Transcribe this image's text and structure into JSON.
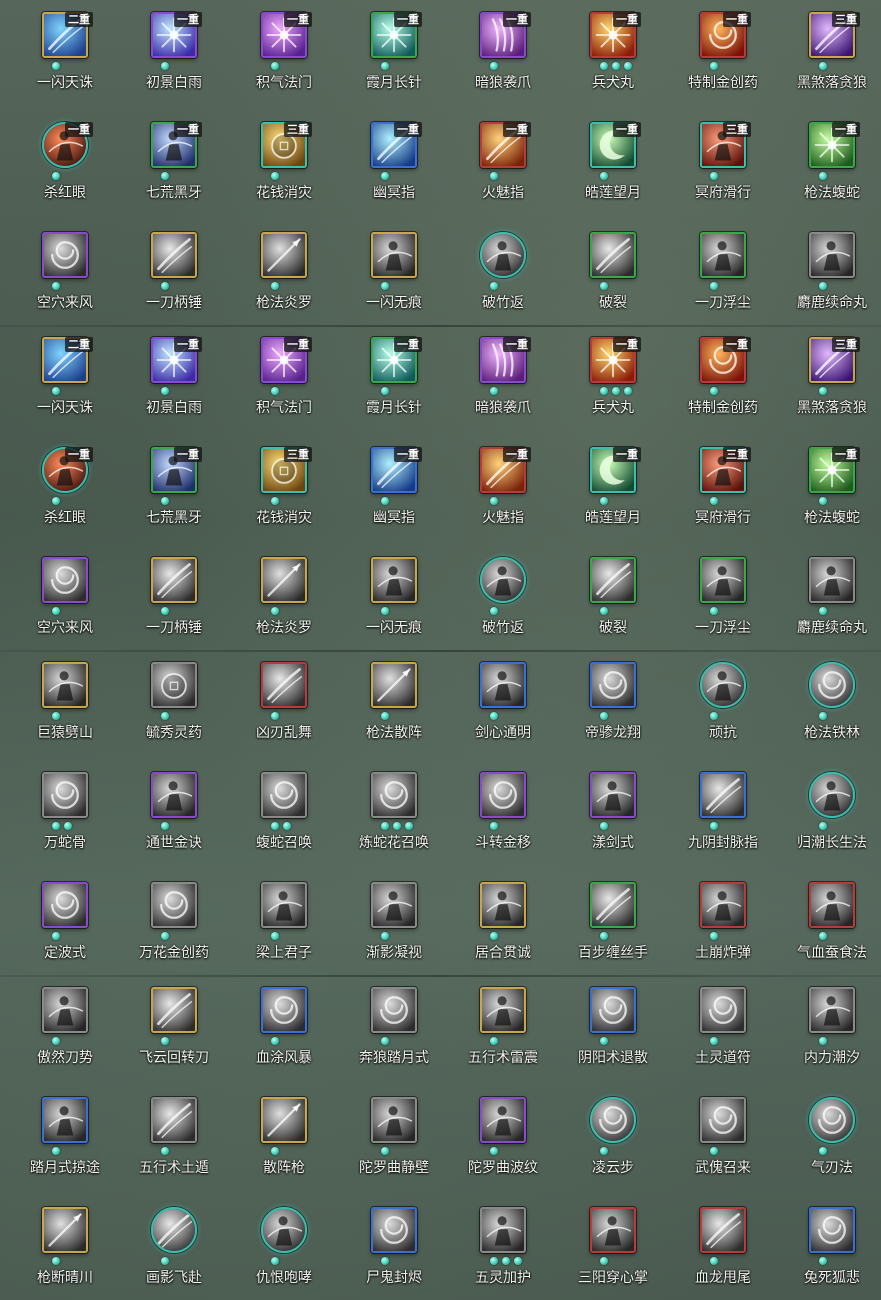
{
  "badge_colors": {
    "gold": "#c9a64b",
    "purple": "#8a4ad0",
    "blue": "#3a6fd6",
    "green": "#39a84a",
    "red": "#b83a3a",
    "gray": "#8a8a8a",
    "teal": "#38bfae"
  },
  "sections": [
    {
      "rows": [
        [
          {
            "name": "一闪天诛",
            "badge": "二重",
            "dots": 1,
            "frame": "gold",
            "shape": "square",
            "art": "slash-blue"
          },
          {
            "name": "初景白雨",
            "badge": "一重",
            "dots": 1,
            "frame": "purple",
            "shape": "square",
            "art": "burst-blue"
          },
          {
            "name": "积气法门",
            "badge": "一重",
            "dots": 1,
            "frame": "purple",
            "shape": "square",
            "art": "burst-violet"
          },
          {
            "name": "霞月长针",
            "badge": "一重",
            "dots": 1,
            "frame": "green",
            "shape": "square",
            "art": "burst-teal"
          },
          {
            "name": "暗狼袭爪",
            "badge": "一重",
            "dots": 1,
            "frame": "purple",
            "shape": "square",
            "art": "claw-violet"
          },
          {
            "name": "兵犬丸",
            "badge": "一重",
            "dots": 3,
            "frame": "red",
            "shape": "square",
            "art": "fire"
          },
          {
            "name": "特制金创药",
            "badge": "一重",
            "dots": 1,
            "frame": "red",
            "shape": "square",
            "art": "fire-swirl"
          },
          {
            "name": "黑煞落贪狼",
            "badge": "三重",
            "dots": 1,
            "frame": "gold",
            "shape": "square",
            "art": "slash-violet"
          }
        ],
        [
          {
            "name": "杀红眼",
            "badge": "一重",
            "dots": 1,
            "frame": "teal",
            "shape": "round",
            "art": "figure-red"
          },
          {
            "name": "七荒黑牙",
            "badge": "一重",
            "dots": 1,
            "frame": "green",
            "shape": "square",
            "art": "beast-blue"
          },
          {
            "name": "花钱消灾",
            "badge": "三重",
            "dots": 1,
            "frame": "teal",
            "shape": "square",
            "art": "coin-gold"
          },
          {
            "name": "幽冥指",
            "badge": "一重",
            "dots": 1,
            "frame": "blue",
            "shape": "square",
            "art": "strike-blue"
          },
          {
            "name": "火魅指",
            "badge": "一重",
            "dots": 1,
            "frame": "red",
            "shape": "square",
            "art": "strike-orange"
          },
          {
            "name": "皓莲望月",
            "badge": "一重",
            "dots": 1,
            "frame": "teal",
            "shape": "square",
            "art": "moon-green"
          },
          {
            "name": "冥府滑行",
            "badge": "三重",
            "dots": 1,
            "frame": "teal",
            "shape": "square",
            "art": "rider-red"
          },
          {
            "name": "枪法蝮蛇",
            "badge": "一重",
            "dots": 1,
            "frame": "green",
            "shape": "square",
            "art": "burst-green"
          }
        ],
        [
          {
            "name": "空穴来风",
            "badge": "",
            "dots": 1,
            "frame": "purple",
            "shape": "square",
            "art": "gray-swirl"
          },
          {
            "name": "一刀柄锤",
            "badge": "",
            "dots": 1,
            "frame": "gold",
            "shape": "square",
            "art": "gray-slash"
          },
          {
            "name": "枪法炎罗",
            "badge": "",
            "dots": 1,
            "frame": "gold",
            "shape": "square",
            "art": "gray-spear"
          },
          {
            "name": "一闪无痕",
            "badge": "",
            "dots": 1,
            "frame": "gold",
            "shape": "square",
            "art": "gray-figure"
          },
          {
            "name": "破竹返",
            "badge": "",
            "dots": 1,
            "frame": "teal",
            "shape": "round",
            "art": "gray-figure"
          },
          {
            "name": "破裂",
            "badge": "",
            "dots": 1,
            "frame": "green",
            "shape": "square",
            "art": "gray-slash"
          },
          {
            "name": "一刀浮尘",
            "badge": "",
            "dots": 1,
            "frame": "green",
            "shape": "square",
            "art": "gray-figure"
          },
          {
            "name": "麝鹿续命丸",
            "badge": "",
            "dots": 1,
            "frame": "gray",
            "shape": "square",
            "art": "gray-figure"
          }
        ]
      ]
    },
    {
      "rows": [
        [
          {
            "name": "一闪天诛",
            "badge": "二重",
            "dots": 1,
            "frame": "gold",
            "shape": "square",
            "art": "slash-blue"
          },
          {
            "name": "初景白雨",
            "badge": "一重",
            "dots": 1,
            "frame": "purple",
            "shape": "square",
            "art": "burst-blue"
          },
          {
            "name": "积气法门",
            "badge": "一重",
            "dots": 1,
            "frame": "purple",
            "shape": "square",
            "art": "burst-violet"
          },
          {
            "name": "霞月长针",
            "badge": "一重",
            "dots": 1,
            "frame": "green",
            "shape": "square",
            "art": "burst-teal"
          },
          {
            "name": "暗狼袭爪",
            "badge": "一重",
            "dots": 1,
            "frame": "purple",
            "shape": "square",
            "art": "claw-violet"
          },
          {
            "name": "兵犬丸",
            "badge": "一重",
            "dots": 3,
            "frame": "red",
            "shape": "square",
            "art": "fire"
          },
          {
            "name": "特制金创药",
            "badge": "一重",
            "dots": 1,
            "frame": "red",
            "shape": "square",
            "art": "fire-swirl"
          },
          {
            "name": "黑煞落贪狼",
            "badge": "三重",
            "dots": 1,
            "frame": "gold",
            "shape": "square",
            "art": "slash-violet"
          }
        ],
        [
          {
            "name": "杀红眼",
            "badge": "一重",
            "dots": 1,
            "frame": "teal",
            "shape": "round",
            "art": "figure-red"
          },
          {
            "name": "七荒黑牙",
            "badge": "一重",
            "dots": 1,
            "frame": "green",
            "shape": "square",
            "art": "beast-blue"
          },
          {
            "name": "花钱消灾",
            "badge": "三重",
            "dots": 1,
            "frame": "teal",
            "shape": "square",
            "art": "coin-gold"
          },
          {
            "name": "幽冥指",
            "badge": "一重",
            "dots": 1,
            "frame": "blue",
            "shape": "square",
            "art": "strike-blue"
          },
          {
            "name": "火魅指",
            "badge": "一重",
            "dots": 1,
            "frame": "red",
            "shape": "square",
            "art": "strike-orange"
          },
          {
            "name": "皓莲望月",
            "badge": "一重",
            "dots": 1,
            "frame": "teal",
            "shape": "square",
            "art": "moon-green"
          },
          {
            "name": "冥府滑行",
            "badge": "三重",
            "dots": 1,
            "frame": "teal",
            "shape": "square",
            "art": "rider-red"
          },
          {
            "name": "枪法蝮蛇",
            "badge": "一重",
            "dots": 1,
            "frame": "green",
            "shape": "square",
            "art": "burst-green"
          }
        ],
        [
          {
            "name": "空穴来风",
            "badge": "",
            "dots": 1,
            "frame": "purple",
            "shape": "square",
            "art": "gray-swirl"
          },
          {
            "name": "一刀柄锤",
            "badge": "",
            "dots": 1,
            "frame": "gold",
            "shape": "square",
            "art": "gray-slash"
          },
          {
            "name": "枪法炎罗",
            "badge": "",
            "dots": 1,
            "frame": "gold",
            "shape": "square",
            "art": "gray-spear"
          },
          {
            "name": "一闪无痕",
            "badge": "",
            "dots": 1,
            "frame": "gold",
            "shape": "square",
            "art": "gray-figure"
          },
          {
            "name": "破竹返",
            "badge": "",
            "dots": 1,
            "frame": "teal",
            "shape": "round",
            "art": "gray-figure"
          },
          {
            "name": "破裂",
            "badge": "",
            "dots": 1,
            "frame": "green",
            "shape": "square",
            "art": "gray-slash"
          },
          {
            "name": "一刀浮尘",
            "badge": "",
            "dots": 1,
            "frame": "green",
            "shape": "square",
            "art": "gray-figure"
          },
          {
            "name": "麝鹿续命丸",
            "badge": "",
            "dots": 1,
            "frame": "gray",
            "shape": "square",
            "art": "gray-figure"
          }
        ]
      ]
    },
    {
      "rows": [
        [
          {
            "name": "巨猿劈山",
            "badge": "",
            "dots": 1,
            "frame": "gold",
            "shape": "square",
            "art": "gray-figure"
          },
          {
            "name": "毓秀灵药",
            "badge": "",
            "dots": 1,
            "frame": "gray",
            "shape": "square",
            "art": "gray-gourd"
          },
          {
            "name": "凶刃乱舞",
            "badge": "",
            "dots": 1,
            "frame": "red",
            "shape": "square",
            "art": "gray-slash"
          },
          {
            "name": "枪法散阵",
            "badge": "",
            "dots": 1,
            "frame": "gold",
            "shape": "square",
            "art": "gray-spear"
          },
          {
            "name": "剑心通明",
            "badge": "",
            "dots": 1,
            "frame": "blue",
            "shape": "square",
            "art": "gray-figure"
          },
          {
            "name": "帝骖龙翔",
            "badge": "",
            "dots": 1,
            "frame": "blue",
            "shape": "square",
            "art": "gray-swirl"
          },
          {
            "name": "顽抗",
            "badge": "",
            "dots": 1,
            "frame": "teal",
            "shape": "round",
            "art": "gray-figure"
          },
          {
            "name": "枪法铁林",
            "badge": "",
            "dots": 1,
            "frame": "teal",
            "shape": "round",
            "art": "gray-swirl"
          }
        ],
        [
          {
            "name": "万蛇骨",
            "badge": "",
            "dots": 2,
            "frame": "gray",
            "shape": "square",
            "art": "gray-swirl"
          },
          {
            "name": "通世金诀",
            "badge": "",
            "dots": 1,
            "frame": "purple",
            "shape": "square",
            "art": "gray-figure"
          },
          {
            "name": "蝮蛇召唤",
            "badge": "",
            "dots": 2,
            "frame": "gray",
            "shape": "square",
            "art": "gray-swirl"
          },
          {
            "name": "炼蛇花召唤",
            "badge": "",
            "dots": 3,
            "frame": "gray",
            "shape": "square",
            "art": "gray-swirl"
          },
          {
            "name": "斗转金移",
            "badge": "",
            "dots": 1,
            "frame": "purple",
            "shape": "square",
            "art": "gray-swirl"
          },
          {
            "name": "漾剑式",
            "badge": "",
            "dots": 1,
            "frame": "purple",
            "shape": "square",
            "art": "gray-figure"
          },
          {
            "name": "九阴封脉指",
            "badge": "",
            "dots": 1,
            "frame": "blue",
            "shape": "square",
            "art": "gray-slash"
          },
          {
            "name": "归潮长生法",
            "badge": "",
            "dots": 1,
            "frame": "teal",
            "shape": "round",
            "art": "gray-figure"
          }
        ],
        [
          {
            "name": "定波式",
            "badge": "",
            "dots": 1,
            "frame": "purple",
            "shape": "square",
            "art": "gray-swirl"
          },
          {
            "name": "万花金创药",
            "badge": "",
            "dots": 1,
            "frame": "gray",
            "shape": "square",
            "art": "gray-swirl"
          },
          {
            "name": "梁上君子",
            "badge": "",
            "dots": 1,
            "frame": "gray",
            "shape": "square",
            "art": "gray-figure"
          },
          {
            "name": "渐影凝视",
            "badge": "",
            "dots": 1,
            "frame": "gray",
            "shape": "square",
            "art": "gray-figure"
          },
          {
            "name": "居合贯诚",
            "badge": "",
            "dots": 1,
            "frame": "gold",
            "shape": "square",
            "art": "gray-figure"
          },
          {
            "name": "百步缠丝手",
            "badge": "",
            "dots": 1,
            "frame": "green",
            "shape": "square",
            "art": "gray-slash"
          },
          {
            "name": "土崩炸弹",
            "badge": "",
            "dots": 1,
            "frame": "red",
            "shape": "square",
            "art": "gray-figure"
          },
          {
            "name": "气血蚕食法",
            "badge": "",
            "dots": 1,
            "frame": "red",
            "shape": "square",
            "art": "gray-figure"
          }
        ]
      ]
    },
    {
      "rows": [
        [
          {
            "name": "傲然刀势",
            "badge": "",
            "dots": 1,
            "frame": "gray",
            "shape": "square",
            "art": "gray-figure"
          },
          {
            "name": "飞云回转刀",
            "badge": "",
            "dots": 1,
            "frame": "gold",
            "shape": "square",
            "art": "gray-slash"
          },
          {
            "name": "血涂风暴",
            "badge": "",
            "dots": 1,
            "frame": "blue",
            "shape": "square",
            "art": "gray-swirl"
          },
          {
            "name": "奔狼踏月式",
            "badge": "",
            "dots": 1,
            "frame": "gray",
            "shape": "square",
            "art": "gray-swirl"
          },
          {
            "name": "五行术雷震",
            "badge": "",
            "dots": 1,
            "frame": "gold",
            "shape": "square",
            "art": "gray-figure"
          },
          {
            "name": "阴阳术退散",
            "badge": "",
            "dots": 1,
            "frame": "blue",
            "shape": "square",
            "art": "gray-swirl"
          },
          {
            "name": "土灵道符",
            "badge": "",
            "dots": 1,
            "frame": "gray",
            "shape": "square",
            "art": "gray-swirl"
          },
          {
            "name": "内力潮汐",
            "badge": "",
            "dots": 1,
            "frame": "gray",
            "shape": "square",
            "art": "gray-figure"
          }
        ],
        [
          {
            "name": "踏月式掠途",
            "badge": "",
            "dots": 1,
            "frame": "blue",
            "shape": "square",
            "art": "gray-figure"
          },
          {
            "name": "五行术土遁",
            "badge": "",
            "dots": 1,
            "frame": "gray",
            "shape": "square",
            "art": "gray-slash"
          },
          {
            "name": "散阵枪",
            "badge": "",
            "dots": 1,
            "frame": "gold",
            "shape": "square",
            "art": "gray-spear"
          },
          {
            "name": "陀罗曲静壁",
            "badge": "",
            "dots": 1,
            "frame": "gray",
            "shape": "square",
            "art": "gray-figure"
          },
          {
            "name": "陀罗曲波纹",
            "badge": "",
            "dots": 1,
            "frame": "purple",
            "shape": "square",
            "art": "gray-figure"
          },
          {
            "name": "凌云步",
            "badge": "",
            "dots": 1,
            "frame": "teal",
            "shape": "round",
            "art": "gray-swirl"
          },
          {
            "name": "武傀召来",
            "badge": "",
            "dots": 1,
            "frame": "gray",
            "shape": "square",
            "art": "gray-swirl"
          },
          {
            "name": "气刃法",
            "badge": "",
            "dots": 1,
            "frame": "teal",
            "shape": "round",
            "art": "gray-swirl"
          }
        ],
        [
          {
            "name": "枪断晴川",
            "badge": "",
            "dots": 1,
            "frame": "gold",
            "shape": "square",
            "art": "gray-spear"
          },
          {
            "name": "画影飞赴",
            "badge": "",
            "dots": 1,
            "frame": "teal",
            "shape": "round",
            "art": "gray-slash"
          },
          {
            "name": "仇恨咆哮",
            "badge": "",
            "dots": 1,
            "frame": "teal",
            "shape": "round",
            "art": "gray-figure"
          },
          {
            "name": "尸鬼封烬",
            "badge": "",
            "dots": 1,
            "frame": "blue",
            "shape": "square",
            "art": "gray-swirl"
          },
          {
            "name": "五灵加护",
            "badge": "",
            "dots": 3,
            "frame": "gray",
            "shape": "square",
            "art": "gray-figure"
          },
          {
            "name": "三阳穿心掌",
            "badge": "",
            "dots": 1,
            "frame": "red",
            "shape": "square",
            "art": "gray-figure"
          },
          {
            "name": "血龙甩尾",
            "badge": "",
            "dots": 1,
            "frame": "red",
            "shape": "square",
            "art": "gray-slash"
          },
          {
            "name": "兔死狐悲",
            "badge": "",
            "dots": 1,
            "frame": "blue",
            "shape": "square",
            "art": "gray-swirl"
          }
        ]
      ]
    }
  ]
}
